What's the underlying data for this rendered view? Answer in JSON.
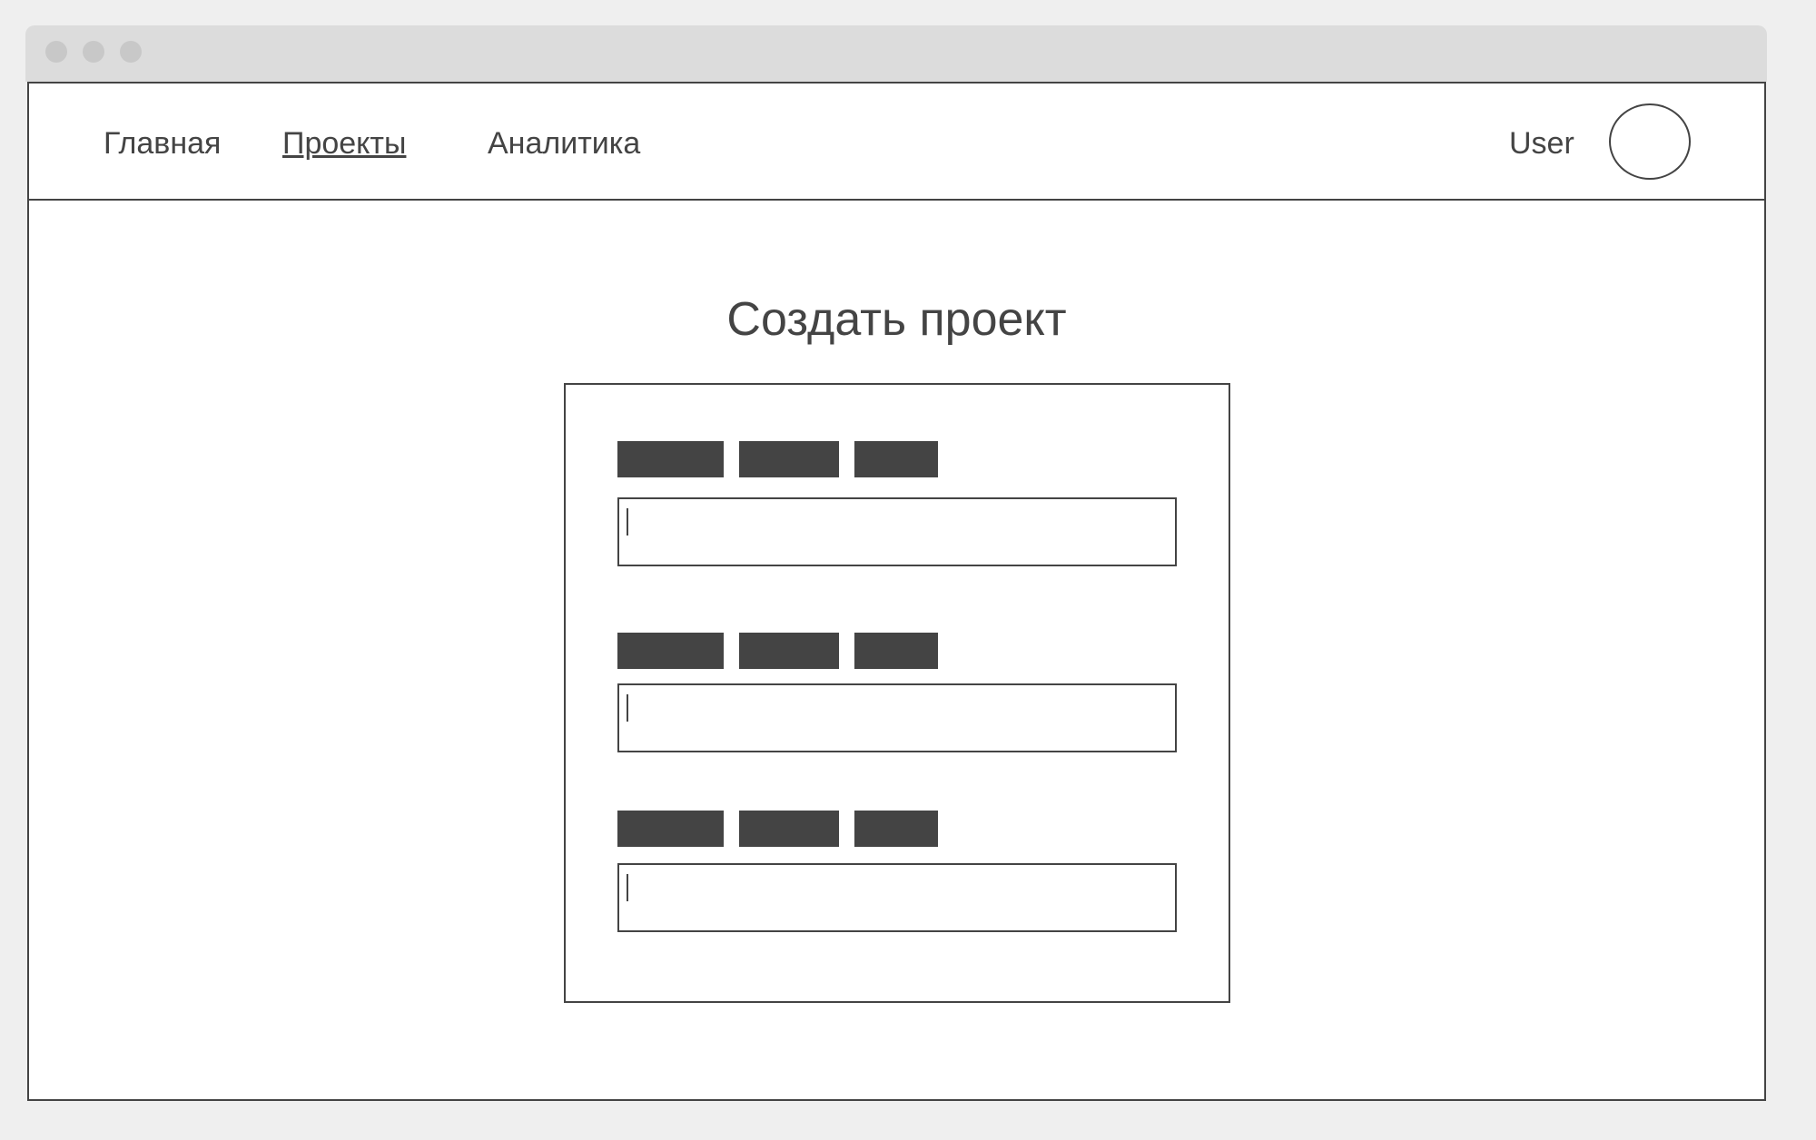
{
  "nav": {
    "items": [
      {
        "label": "Главная",
        "active": false
      },
      {
        "label": "Проекты",
        "active": true
      },
      {
        "label": "Аналитика",
        "active": false
      }
    ]
  },
  "user": {
    "name": "User"
  },
  "main": {
    "title": "Создать проект"
  },
  "form": {
    "fields": [
      {
        "value": "",
        "placeholder": ""
      },
      {
        "value": "",
        "placeholder": ""
      },
      {
        "value": "",
        "placeholder": ""
      }
    ]
  },
  "colors": {
    "ink": "#444444",
    "page_background": "#efefef",
    "titlebar": "#dcdcdc",
    "window_dots": "#c8c8c8",
    "surface": "#ffffff"
  },
  "icons": {
    "window_controls": "window-dot-icon",
    "avatar": "user-avatar-icon"
  }
}
